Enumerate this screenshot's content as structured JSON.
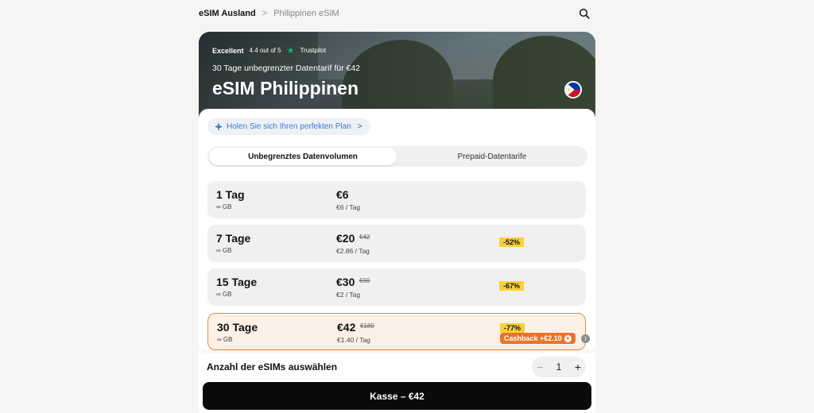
{
  "breadcrumb": {
    "root": "eSIM Ausland",
    "separator": ">",
    "current": "Philippinen eSIM"
  },
  "hero": {
    "rating_label": "Excellent",
    "rating_text": "4.4 out of 5",
    "trustpilot": "Trustpilot",
    "subtitle": "30 Tage unbegrenzter Datentarif für €42",
    "title": "eSIM Philippinen"
  },
  "ai_pill": {
    "label": "Holen Sie sich Ihren perfekten Plan",
    "chevron": ">"
  },
  "tabs": [
    {
      "label": "Unbegrenztes Datenvolumen",
      "active": true
    },
    {
      "label": "Prepaid-Datentarife",
      "active": false
    }
  ],
  "plans": [
    {
      "days": "1 Tag",
      "gb": "∞ GB",
      "price": "€6",
      "old_price": "",
      "per_day": "€6 / Tag",
      "discount": "",
      "selected": false
    },
    {
      "days": "7 Tage",
      "gb": "∞ GB",
      "price": "€20",
      "old_price": "€42",
      "per_day": "€2.86 / Tag",
      "discount": "-52%",
      "selected": false
    },
    {
      "days": "15 Tage",
      "gb": "∞ GB",
      "price": "€30",
      "old_price": "€90",
      "per_day": "€2 / Tag",
      "discount": "-67%",
      "selected": false
    },
    {
      "days": "30 Tage",
      "gb": "∞ GB",
      "price": "€42",
      "old_price": "€180",
      "per_day": "€1.40 / Tag",
      "discount": "-77%",
      "selected": true
    }
  ],
  "cashback": {
    "label": "Cashback +€2.10",
    "info": "i"
  },
  "quantity": {
    "label": "Anzahl der eSIMs auswählen",
    "value": "1",
    "minus": "−",
    "plus": "+"
  },
  "checkout": {
    "label": "Kasse – €42"
  },
  "colors": {
    "accent": "#e9742b",
    "discount": "#f6d23a",
    "button": "#0b0b0b",
    "link": "#3b7ad6"
  }
}
